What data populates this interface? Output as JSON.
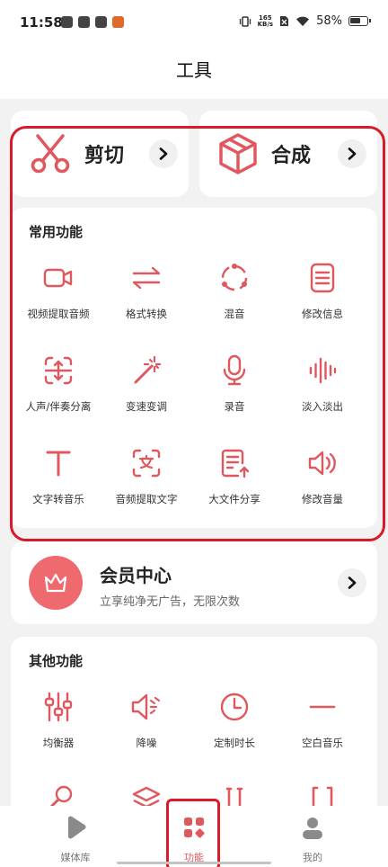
{
  "status_bar": {
    "time": "11:58",
    "speed_value": "165",
    "speed_unit": "KB/s",
    "battery": "58%"
  },
  "header": {
    "title": "工具"
  },
  "big_cards": [
    {
      "label": "剪切",
      "icon": "scissors-icon"
    },
    {
      "label": "合成",
      "icon": "cube-icon"
    }
  ],
  "common": {
    "title": "常用功能",
    "items": [
      {
        "label": "视频提取音频",
        "icon": "video-camera-icon"
      },
      {
        "label": "格式转换",
        "icon": "swap-arrows-icon"
      },
      {
        "label": "混音",
        "icon": "mix-circle-icon"
      },
      {
        "label": "修改信息",
        "icon": "document-icon"
      },
      {
        "label": "人声/伴奏分离",
        "icon": "split-icon"
      },
      {
        "label": "变速变调",
        "icon": "magic-wand-icon"
      },
      {
        "label": "录音",
        "icon": "microphone-icon"
      },
      {
        "label": "淡入淡出",
        "icon": "waveform-icon"
      },
      {
        "label": "文字转音乐",
        "icon": "text-t-icon"
      },
      {
        "label": "音频提取文字",
        "icon": "scan-text-icon"
      },
      {
        "label": "大文件分享",
        "icon": "file-share-icon"
      },
      {
        "label": "修改音量",
        "icon": "speaker-icon"
      }
    ]
  },
  "vip": {
    "title": "会员中心",
    "subtitle": "立享纯净无广告，无限次数",
    "icon": "crown-icon"
  },
  "other": {
    "title": "其他功能",
    "items": [
      {
        "label": "均衡器",
        "icon": "equalizer-icon"
      },
      {
        "label": "降噪",
        "icon": "noise-reduce-icon"
      },
      {
        "label": "定制时长",
        "icon": "clock-icon"
      },
      {
        "label": "空白音乐",
        "icon": "minus-icon"
      }
    ]
  },
  "bottom_nav": [
    {
      "label": "媒体库",
      "icon": "play-icon",
      "active": false
    },
    {
      "label": "功能",
      "icon": "apps-icon",
      "active": true
    },
    {
      "label": "我的",
      "icon": "user-icon",
      "active": false
    }
  ],
  "colors": {
    "accent": "#e0585e",
    "highlight": "#d91a2a"
  }
}
